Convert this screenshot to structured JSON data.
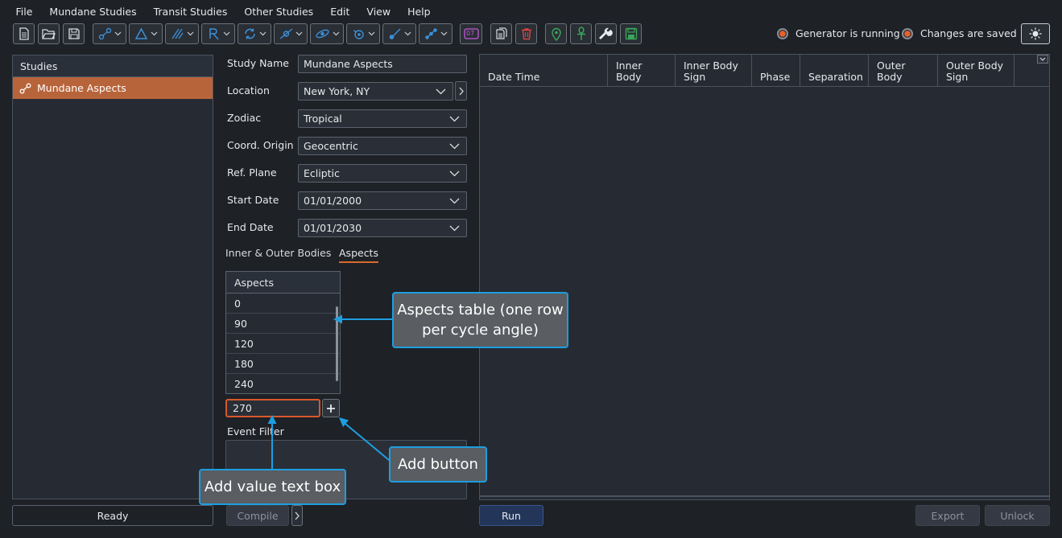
{
  "menu": [
    "File",
    "Mundane Studies",
    "Transit Studies",
    "Other Studies",
    "Edit",
    "View",
    "Help"
  ],
  "toolbar": {
    "calendar_badge": "07"
  },
  "status": {
    "generator": "Generator is running",
    "changes": "Changes are saved"
  },
  "studies": {
    "header": "Studies",
    "items": [
      "Mundane Aspects"
    ],
    "status": "Ready"
  },
  "form": {
    "study_name_label": "Study Name",
    "study_name_value": "Mundane Aspects",
    "location_label": "Location",
    "location_value": "New York, NY",
    "zodiac_label": "Zodiac",
    "zodiac_value": "Tropical",
    "coord_label": "Coord. Origin",
    "coord_value": "Geocentric",
    "refplane_label": "Ref. Plane",
    "refplane_value": "Ecliptic",
    "start_label": "Start Date",
    "start_value": "01/01/2000",
    "end_label": "End Date",
    "end_value": "01/01/2030",
    "tab_bodies": "Inner & Outer Bodies",
    "tab_aspects": "Aspects",
    "aspects_header": "Aspects",
    "aspects_rows": [
      "0",
      "90",
      "120",
      "180",
      "240"
    ],
    "add_value": "270",
    "event_filter_label": "Event Filter",
    "compile_label": "Compile"
  },
  "results": {
    "col1": "Date Time",
    "col2": "Inner Body",
    "col3": "Inner Body\nSign",
    "col4": "Phase",
    "col5": "Separation",
    "col6": "Outer Body",
    "col7": "Outer Body\nSign",
    "run_label": "Run",
    "export_label": "Export",
    "unlock_label": "Unlock"
  },
  "callouts": {
    "aspects_table": "Aspects table (one row per cycle angle)",
    "add_button": "Add button",
    "add_value_box": "Add value text box"
  },
  "colors": {
    "accent": "#d86a2e",
    "selection": "#b8643a",
    "callout_border": "#1e9ee0",
    "icon_blue": "#3b8fd6",
    "icon_green": "#3aa55b",
    "icon_red": "#d64545"
  }
}
